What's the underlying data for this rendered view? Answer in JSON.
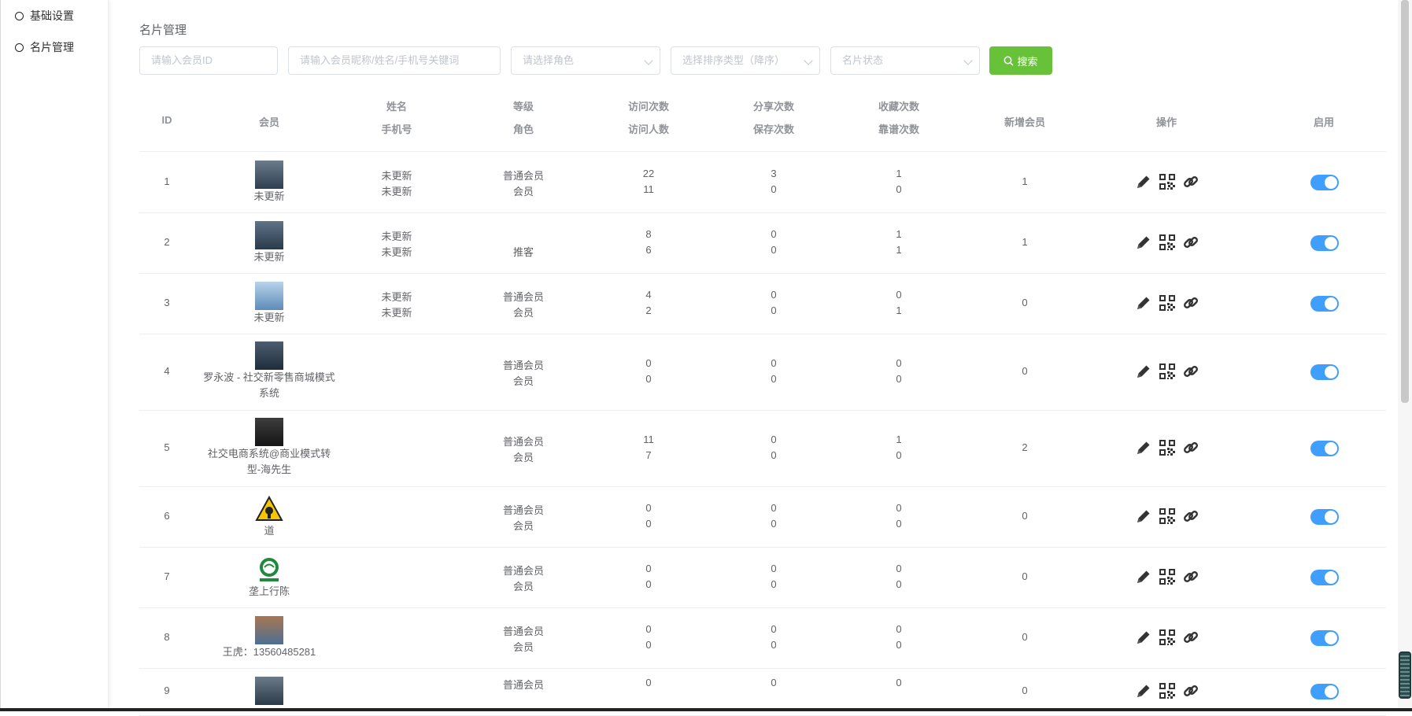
{
  "sidebar": {
    "items": [
      {
        "label": "基础设置"
      },
      {
        "label": "名片管理"
      }
    ]
  },
  "page": {
    "title": "名片管理"
  },
  "filters": {
    "member_id_placeholder": "请输入会员ID",
    "keyword_placeholder": "请输入会员昵称/姓名/手机号关键词",
    "role_placeholder": "请选择角色",
    "sort_placeholder": "选择排序类型（降序）",
    "status_placeholder": "名片状态",
    "search_label": "搜索"
  },
  "table": {
    "headers": {
      "id": "ID",
      "member": "会员",
      "name": "姓名",
      "phone": "手机号",
      "level": "等级",
      "role": "角色",
      "visits": "访问次数",
      "visitors": "访问人数",
      "shares": "分享次数",
      "saves": "保存次数",
      "favorites": "收藏次数",
      "likes": "靠谱次数",
      "new_members": "新增会员",
      "ops": "操作",
      "enabled": "启用"
    },
    "rows": [
      {
        "id": "1",
        "member": "未更新",
        "name": "未更新",
        "phone": "未更新",
        "level": "普通会员",
        "role": "会员",
        "visits": "22",
        "visitors": "11",
        "shares": "3",
        "saves": "0",
        "favorites": "1",
        "likes": "0",
        "new_members": "1",
        "enabled": true
      },
      {
        "id": "2",
        "member": "未更新",
        "name": "未更新",
        "phone": "未更新",
        "level": "",
        "role": "推客",
        "visits": "8",
        "visitors": "6",
        "shares": "0",
        "saves": "0",
        "favorites": "1",
        "likes": "1",
        "new_members": "1",
        "enabled": true
      },
      {
        "id": "3",
        "member": "未更新",
        "name": "未更新",
        "phone": "未更新",
        "level": "普通会员",
        "role": "会员",
        "visits": "4",
        "visitors": "2",
        "shares": "0",
        "saves": "0",
        "favorites": "0",
        "likes": "1",
        "new_members": "0",
        "enabled": true
      },
      {
        "id": "4",
        "member": "罗永波 - 社交新零售商城模式系统",
        "name": "",
        "phone": "",
        "level": "普通会员",
        "role": "会员",
        "visits": "0",
        "visitors": "0",
        "shares": "0",
        "saves": "0",
        "favorites": "0",
        "likes": "0",
        "new_members": "0",
        "enabled": true
      },
      {
        "id": "5",
        "member": "社交电商系统@商业模式转型-海先生",
        "name": "",
        "phone": "",
        "level": "普通会员",
        "role": "会员",
        "visits": "11",
        "visitors": "7",
        "shares": "0",
        "saves": "0",
        "favorites": "1",
        "likes": "0",
        "new_members": "2",
        "enabled": true
      },
      {
        "id": "6",
        "member": "道",
        "name": "",
        "phone": "",
        "level": "普通会员",
        "role": "会员",
        "visits": "0",
        "visitors": "0",
        "shares": "0",
        "saves": "0",
        "favorites": "0",
        "likes": "0",
        "new_members": "0",
        "enabled": true
      },
      {
        "id": "7",
        "member": "垄上行陈",
        "name": "",
        "phone": "",
        "level": "普通会员",
        "role": "会员",
        "visits": "0",
        "visitors": "0",
        "shares": "0",
        "saves": "0",
        "favorites": "0",
        "likes": "0",
        "new_members": "0",
        "enabled": true
      },
      {
        "id": "8",
        "member": "王虎：13560485281",
        "name": "",
        "phone": "",
        "level": "普通会员",
        "role": "会员",
        "visits": "0",
        "visitors": "0",
        "shares": "0",
        "saves": "0",
        "favorites": "0",
        "likes": "0",
        "new_members": "0",
        "enabled": true
      },
      {
        "id": "9",
        "member": "",
        "name": "",
        "phone": "",
        "level": "普通会员",
        "role": "",
        "visits": "0",
        "visitors": "",
        "shares": "0",
        "saves": "",
        "favorites": "0",
        "likes": "",
        "new_members": "0",
        "enabled": true
      }
    ]
  },
  "icons": {
    "edit": "pencil-icon",
    "qrcode": "qrcode-icon",
    "link": "link-icon",
    "search": "search-icon"
  },
  "colors": {
    "primary": "#409eff",
    "success": "#67c23a",
    "text": "#606266",
    "header_text": "#909399",
    "border": "#ebeef5"
  }
}
